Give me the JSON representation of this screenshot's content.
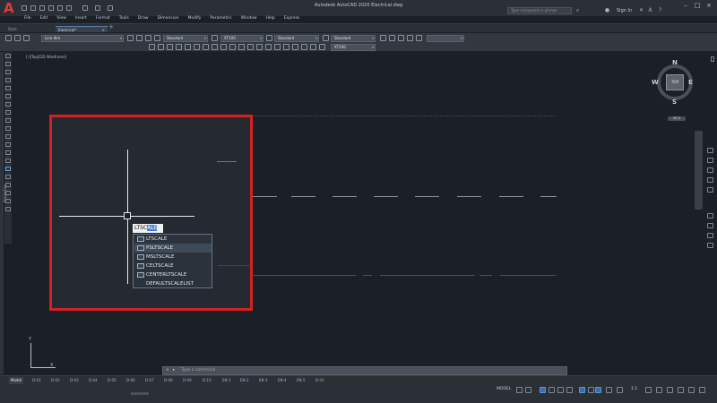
{
  "titlebar": {
    "title": "Autodesk AutoCAD 2020   Electrical.dwg",
    "search_placeholder": "Type a keyword or phrase",
    "signin": "Sign In",
    "app_logo": "A"
  },
  "menu": [
    "File",
    "Edit",
    "View",
    "Insert",
    "Format",
    "Tools",
    "Draw",
    "Dimension",
    "Modify",
    "Parametric",
    "Window",
    "Help",
    "Express"
  ],
  "tabs": {
    "start": "Start",
    "active": "Electrical*",
    "close": "×",
    "add": "+"
  },
  "toolbar": {
    "layer": "Line dim",
    "textstyle": "Standard",
    "dimstyle": "XT100",
    "tablestyle": "Standard",
    "mleaderstyle": "Standard",
    "dimstyle2": "XT100"
  },
  "viewport_label": "[-][Top][2D Wireframe]",
  "viewcube": {
    "top": "TOP",
    "north": "N",
    "south": "S",
    "east": "E",
    "west": "W",
    "wcs": "WCS"
  },
  "properties_label": "Properties",
  "command_input": {
    "typed": "LTSC",
    "suggested": "ALE"
  },
  "autocomplete": [
    "LTSCALE",
    "PSLTSCALE",
    "MSLTSCALE",
    "CELTSCALE",
    "CENTERLTSCALE",
    "DEFAULTSCALELIST"
  ],
  "ucs": {
    "x": "X",
    "y": "Y"
  },
  "command_line": {
    "close": "×",
    "arrow": "▸",
    "prompt": "Type a command"
  },
  "layout_tabs": [
    "Model",
    "D-01",
    "D-02",
    "D-03",
    "D-04",
    "D-05",
    "D-06",
    "D-07",
    "D-08",
    "D-09",
    "D-10",
    "EN-1",
    "EN-2",
    "EN-3",
    "EN-4",
    "EN-5",
    "D-41"
  ],
  "status": {
    "model": "MODEL",
    "scale": "1:1"
  },
  "colors": {
    "highlight": "#d72020",
    "accent": "#3d84d8",
    "magenta_line": "#b01e8f"
  }
}
